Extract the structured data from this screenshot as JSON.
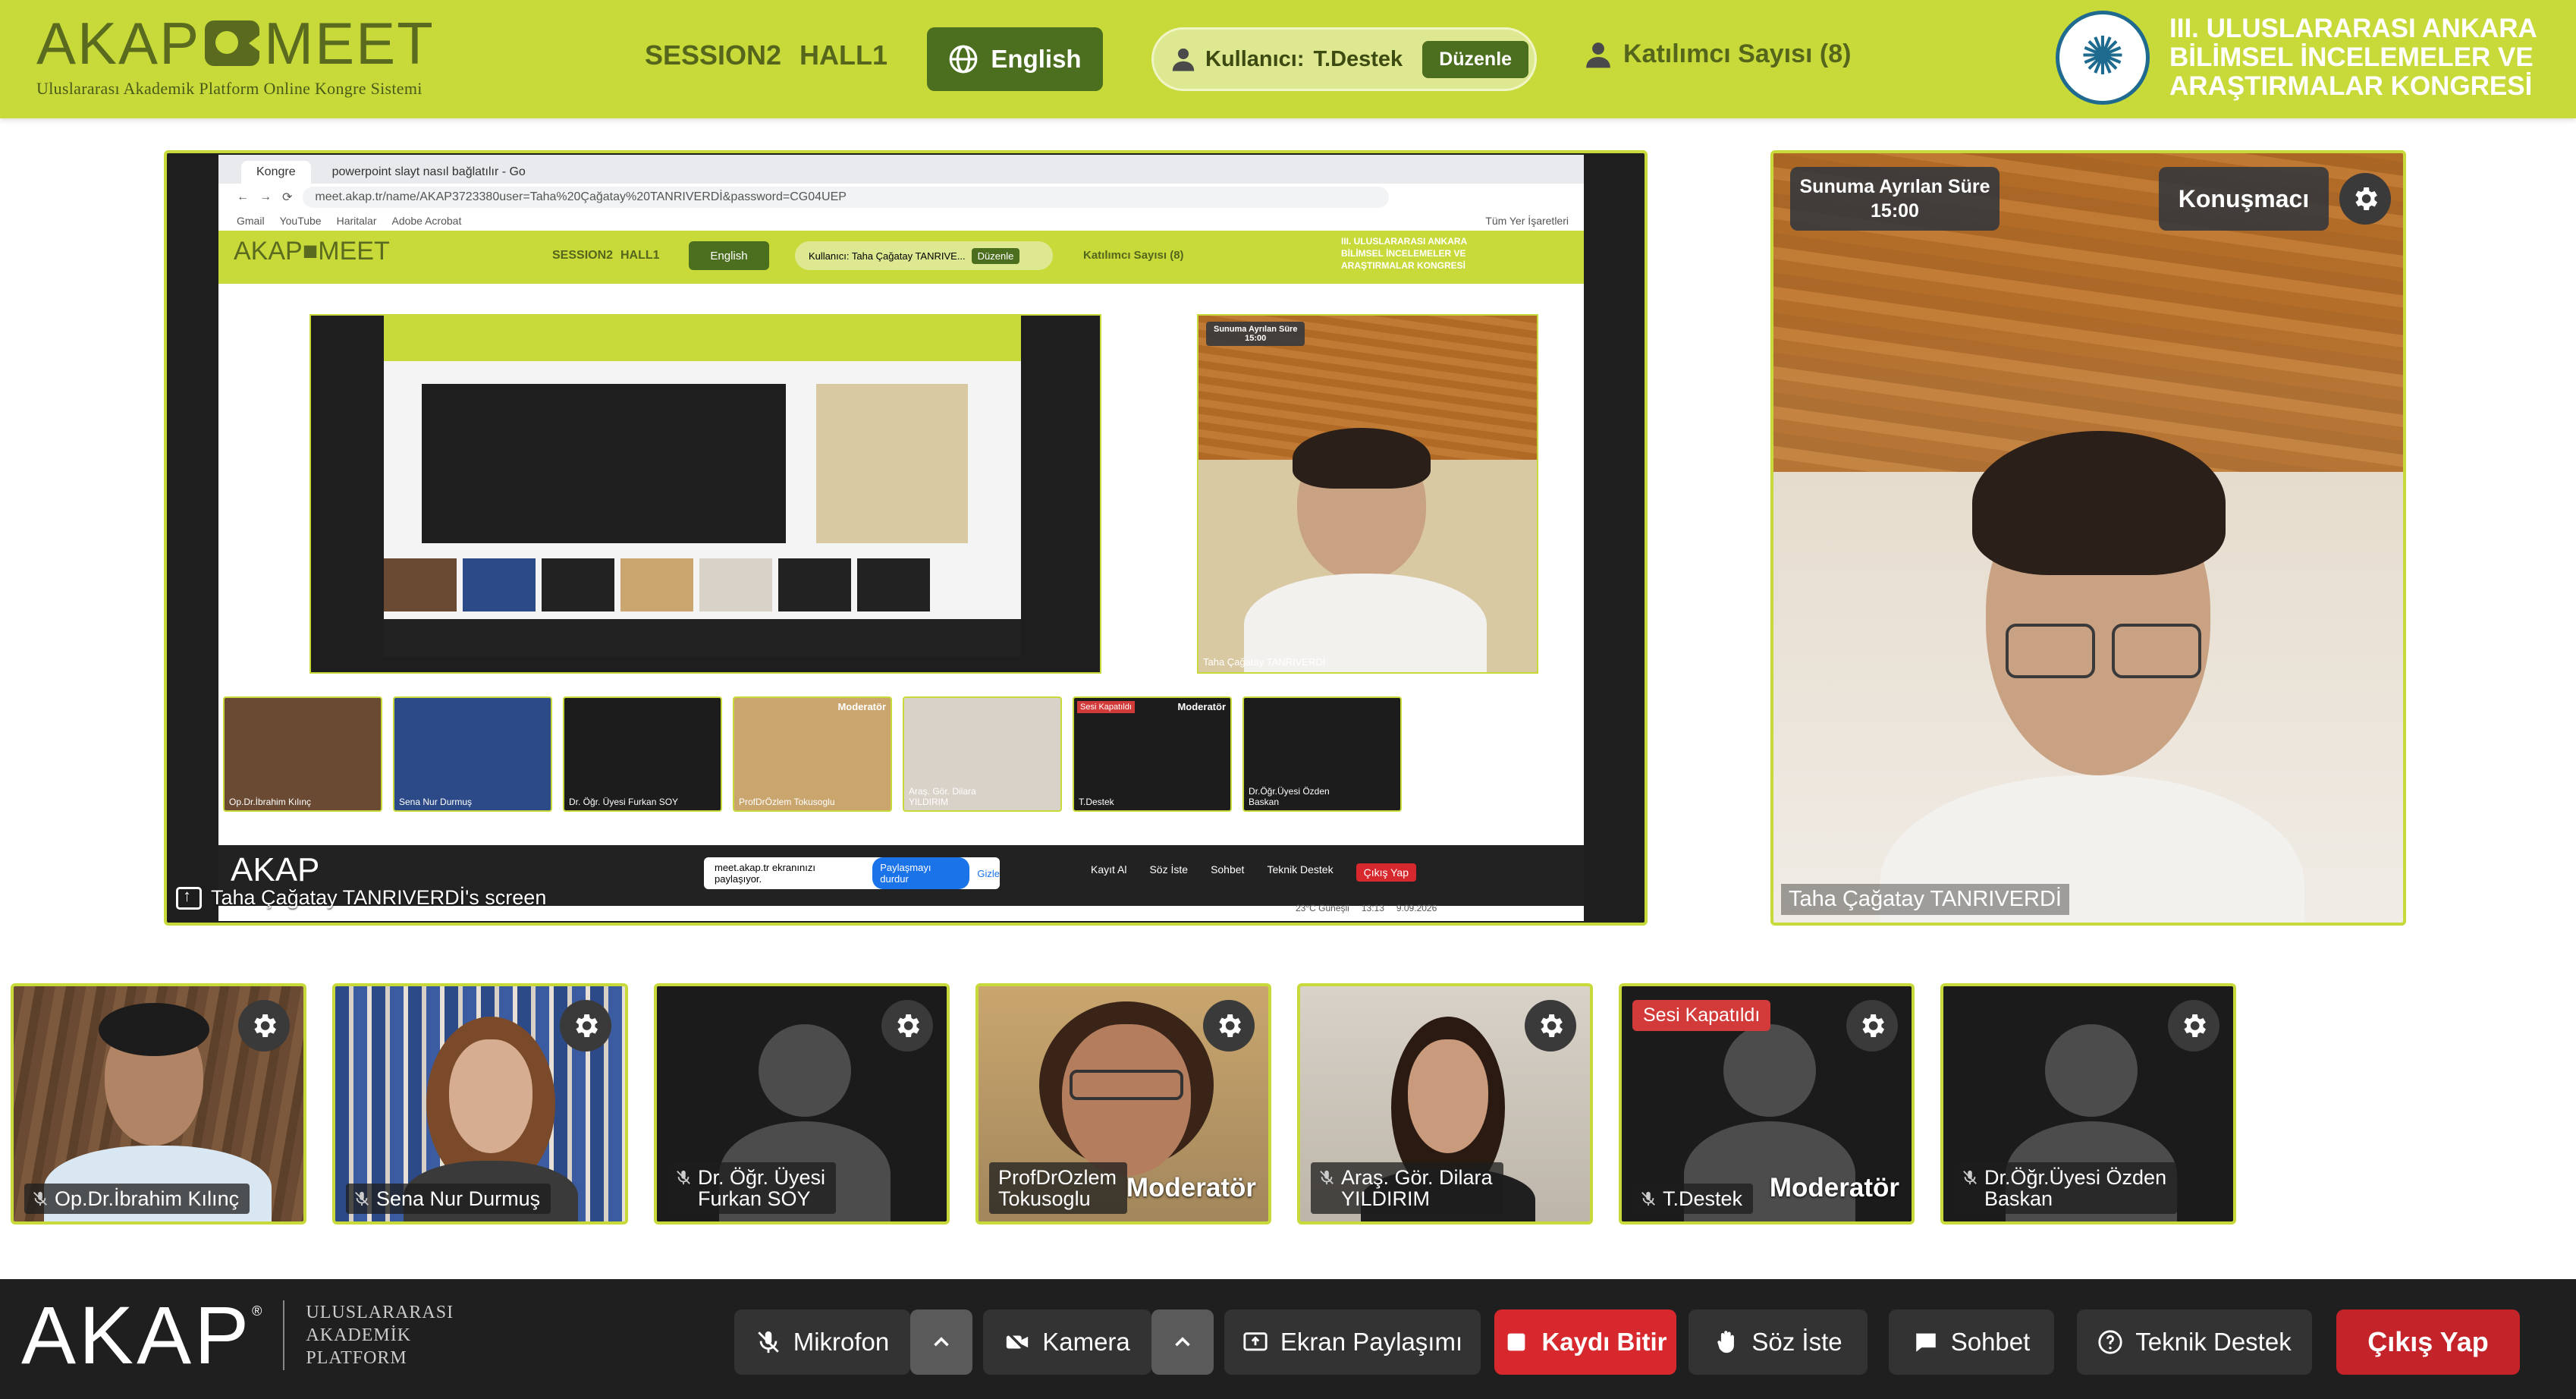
{
  "header": {
    "logo_left": "AKAP",
    "logo_right": "MEET",
    "logo_subtitle": "Uluslararası Akademik Platform Online Kongre Sistemi",
    "session": "SESSION2",
    "hall": "HALL1",
    "language": "English",
    "user_label": "Kullanıcı:",
    "user_name": "T.Destek",
    "edit_label": "Düzenle",
    "participants": "Katılımcı Sayısı (8)",
    "congress_line1": "III. ULUSLARARASI ANKARA",
    "congress_line2": "BİLİMSEL İNCELEMELER VE",
    "congress_line3": "ARAŞTIRMALAR KONGRESİ",
    "accent": "#c8da3a"
  },
  "shared_screen": {
    "label": "Taha Çağatay TANRIVERDİ's screen",
    "browser_tab1": "Kongre",
    "browser_tab2": "powerpoint slayt nasıl bağlatılır - Go",
    "url": "meet.akap.tr/name/AKAP3723380user=Taha%20Çağatay%20TANRIVERDİ&password=CG04UEP",
    "bookmarks": [
      "Gmail",
      "YouTube",
      "Haritalar",
      "Adobe Acrobat"
    ],
    "bookmarks_right": "Tüm Yer İşaretleri",
    "mini_user": "Kullanıcı: Taha Çağatay TANRIVE...",
    "mini_edit": "Düzenle",
    "mini_participants": "Katılımcı Sayısı (8)",
    "mini_timer_title": "Sunuma Ayrılan Süre",
    "mini_timer_value": "15:00",
    "mini_speaker_name": "Taha Çağatay TANRIVERDİ",
    "mini_thumbs": [
      {
        "name": "Op.Dr.İbrahim Kılınç"
      },
      {
        "name": "Sena Nur Durmuş"
      },
      {
        "name": "Dr. Öğr. Üyesi Furkan SOY"
      },
      {
        "name": "ProfDrÖzlem Tokusoglu",
        "badge": "Moderatör"
      },
      {
        "name": "Araş. Gör. Dilara YILDIRIM"
      },
      {
        "name": "T.Destek",
        "badge": "Moderatör",
        "muted": "Sesi Kapatıldı"
      },
      {
        "name": "Dr.Öğr.Üyesi Özden Baskan"
      }
    ],
    "notice_text": "meet.akap.tr ekranınızı paylaşıyor.",
    "notice_stop": "Paylaşmayı durdur",
    "notice_hide": "Gizle",
    "mini_controls": [
      "Kayıt Al",
      "Söz İste",
      "Sohbet",
      "Teknik Destek",
      "Çıkış Yap"
    ],
    "taskbar_weather": "23°C Güneşli",
    "taskbar_time": "13:13",
    "taskbar_date": "9.09.2026"
  },
  "speaker": {
    "timer_title": "Sunuma Ayrılan Süre",
    "timer_value": "15:00",
    "role": "Konuşmacı",
    "name": "Taha Çağatay TANRIVERDİ",
    "settings_icon": "gear-icon"
  },
  "participants": [
    {
      "line1": "Op.Dr.İbrahim Kılınç",
      "line2": "",
      "mic": true,
      "bg": "wood"
    },
    {
      "line1": "Sena Nur Durmuş",
      "line2": "",
      "mic": true,
      "bg": "shelves"
    },
    {
      "line1": "Dr. Öğr. Üyesi",
      "line2": "Furkan SOY",
      "mic": true,
      "bg": "avatar"
    },
    {
      "line1": "ProfDrOzlem",
      "line2": "Tokusoglu",
      "mic": false,
      "bg": "warm",
      "badge": "Moderatör"
    },
    {
      "line1": "Araş. Gör. Dilara",
      "line2": "YILDIRIM",
      "mic": true,
      "bg": "light"
    },
    {
      "line1": "T.Destek",
      "line2": "",
      "mic": true,
      "bg": "avatar",
      "badge": "Moderatör",
      "muted": "Sesi Kapatıldı"
    },
    {
      "line1": "Dr.Öğr.Üyesi Özden",
      "line2": "Baskan",
      "mic": true,
      "bg": "avatar"
    }
  ],
  "bottom": {
    "logo": "AKAP",
    "logo_reg": "®",
    "logo_line1": "ULUSLARARASI",
    "logo_line2": "AKADEMİK",
    "logo_line3": "PLATFORM",
    "mic": "Mikrofon",
    "camera": "Kamera",
    "screen_share": "Ekran Paylaşımı",
    "stop_recording": "Kaydı Bitir",
    "raise_hand": "Söz İste",
    "chat": "Sohbet",
    "support": "Teknik Destek",
    "exit": "Çıkış Yap"
  }
}
